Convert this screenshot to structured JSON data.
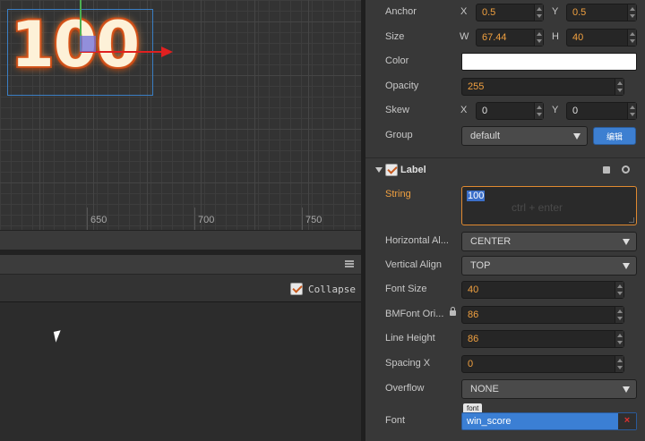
{
  "scene": {
    "label_preview": "100",
    "ruler": [
      "650",
      "700",
      "750"
    ]
  },
  "console": {
    "collapse_label": "Collapse",
    "collapse_checked": true
  },
  "inspector": {
    "anchor": {
      "label": "Anchor",
      "x_axis": "X",
      "x": "0.5",
      "y_axis": "Y",
      "y": "0.5"
    },
    "size": {
      "label": "Size",
      "w_axis": "W",
      "w": "67.44",
      "h_axis": "H",
      "h": "40"
    },
    "color": {
      "label": "Color",
      "value": "#ffffff"
    },
    "opacity": {
      "label": "Opacity",
      "value": "255"
    },
    "skew": {
      "label": "Skew",
      "x_axis": "X",
      "x": "0",
      "y_axis": "Y",
      "y": "0"
    },
    "group": {
      "label": "Group",
      "value": "default",
      "edit_button": "编辑"
    },
    "label_component": {
      "title": "Label",
      "enabled": true,
      "string": {
        "label": "String",
        "value": "100",
        "hint": "ctrl + enter"
      },
      "horizontal_align": {
        "label": "Horizontal Al...",
        "value": "CENTER"
      },
      "vertical_align": {
        "label": "Vertical Align",
        "value": "TOP"
      },
      "font_size": {
        "label": "Font Size",
        "value": "40"
      },
      "bmfont_original_size": {
        "label": "BMFont Ori...",
        "value": "86"
      },
      "line_height": {
        "label": "Line Height",
        "value": "86"
      },
      "spacing_x": {
        "label": "Spacing X",
        "value": "0"
      },
      "overflow": {
        "label": "Overflow",
        "value": "NONE"
      },
      "font": {
        "label": "Font",
        "tag": "font",
        "value": "win_score",
        "clear": "×"
      }
    }
  },
  "colors": {
    "accent_orange": "#f0a040",
    "selection_blue": "#3b7fd4",
    "axis_red": "#e02020",
    "axis_green": "#4caf50"
  }
}
